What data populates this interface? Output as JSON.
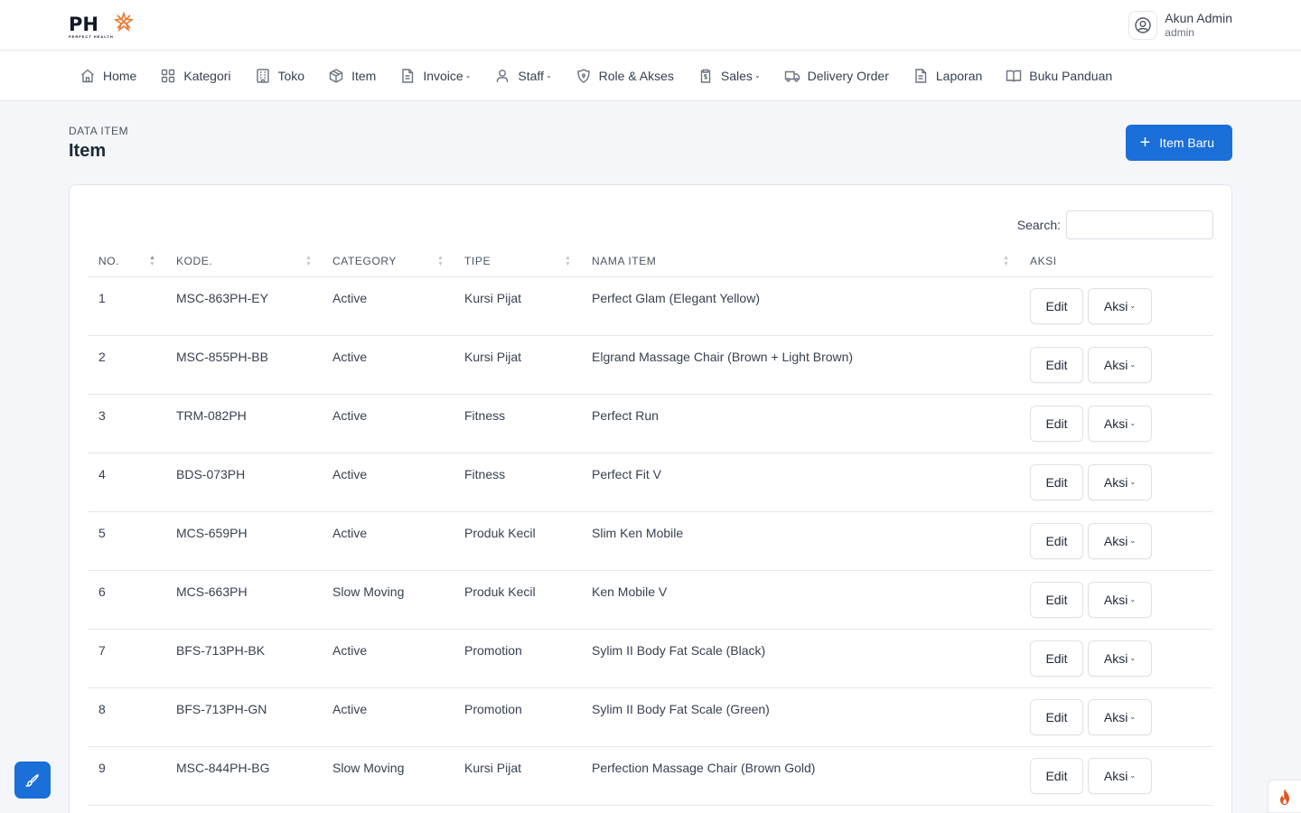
{
  "brand": {
    "logo_text": "PH",
    "logo_subtitle": "PERFECT HEALTH"
  },
  "account": {
    "name": "Akun Admin",
    "role": "admin"
  },
  "nav": [
    {
      "label": "Home",
      "icon": "home-icon",
      "dropdown": false
    },
    {
      "label": "Kategori",
      "icon": "grid-icon",
      "dropdown": false
    },
    {
      "label": "Toko",
      "icon": "building-icon",
      "dropdown": false
    },
    {
      "label": "Item",
      "icon": "box-icon",
      "dropdown": false
    },
    {
      "label": "Invoice",
      "icon": "file-icon",
      "dropdown": true
    },
    {
      "label": "Staff",
      "icon": "user-icon",
      "dropdown": true
    },
    {
      "label": "Role & Akses",
      "icon": "shield-icon",
      "dropdown": false
    },
    {
      "label": "Sales",
      "icon": "clipboard-dollar-icon",
      "dropdown": true
    },
    {
      "label": "Delivery Order",
      "icon": "truck-icon",
      "dropdown": false
    },
    {
      "label": "Laporan",
      "icon": "report-icon",
      "dropdown": false
    },
    {
      "label": "Buku Panduan",
      "icon": "book-icon",
      "dropdown": false
    }
  ],
  "page": {
    "pretitle": "DATA ITEM",
    "title": "Item",
    "new_button": "Item Baru"
  },
  "search": {
    "label": "Search:",
    "value": ""
  },
  "table": {
    "columns": [
      "NO.",
      "KODE.",
      "CATEGORY",
      "TIPE",
      "NAMA ITEM",
      "AKSI"
    ],
    "rows": [
      {
        "no": "1",
        "kode": "MSC-863PH-EY",
        "category": "Active",
        "tipe": "Kursi Pijat",
        "nama": "Perfect Glam (Elegant Yellow)"
      },
      {
        "no": "2",
        "kode": "MSC-855PH-BB",
        "category": "Active",
        "tipe": "Kursi Pijat",
        "nama": "Elgrand Massage Chair (Brown + Light Brown)"
      },
      {
        "no": "3",
        "kode": "TRM-082PH",
        "category": "Active",
        "tipe": "Fitness",
        "nama": "Perfect Run"
      },
      {
        "no": "4",
        "kode": "BDS-073PH",
        "category": "Active",
        "tipe": "Fitness",
        "nama": "Perfect Fit V"
      },
      {
        "no": "5",
        "kode": "MCS-659PH",
        "category": "Active",
        "tipe": "Produk Kecil",
        "nama": "Slim Ken Mobile"
      },
      {
        "no": "6",
        "kode": "MCS-663PH",
        "category": "Slow Moving",
        "tipe": "Produk Kecil",
        "nama": "Ken Mobile V"
      },
      {
        "no": "7",
        "kode": "BFS-713PH-BK",
        "category": "Active",
        "tipe": "Promotion",
        "nama": "Sylim II Body Fat Scale (Black)"
      },
      {
        "no": "8",
        "kode": "BFS-713PH-GN",
        "category": "Active",
        "tipe": "Promotion",
        "nama": "Sylim II Body Fat Scale (Green)"
      },
      {
        "no": "9",
        "kode": "MSC-844PH-BG",
        "category": "Slow Moving",
        "tipe": "Kursi Pijat",
        "nama": "Perfection Massage Chair (Brown Gold)"
      }
    ],
    "edit_label": "Edit",
    "aksi_label": "Aksi"
  },
  "colors": {
    "primary": "#1a6fd8",
    "logo_accent": "#e8772e"
  }
}
